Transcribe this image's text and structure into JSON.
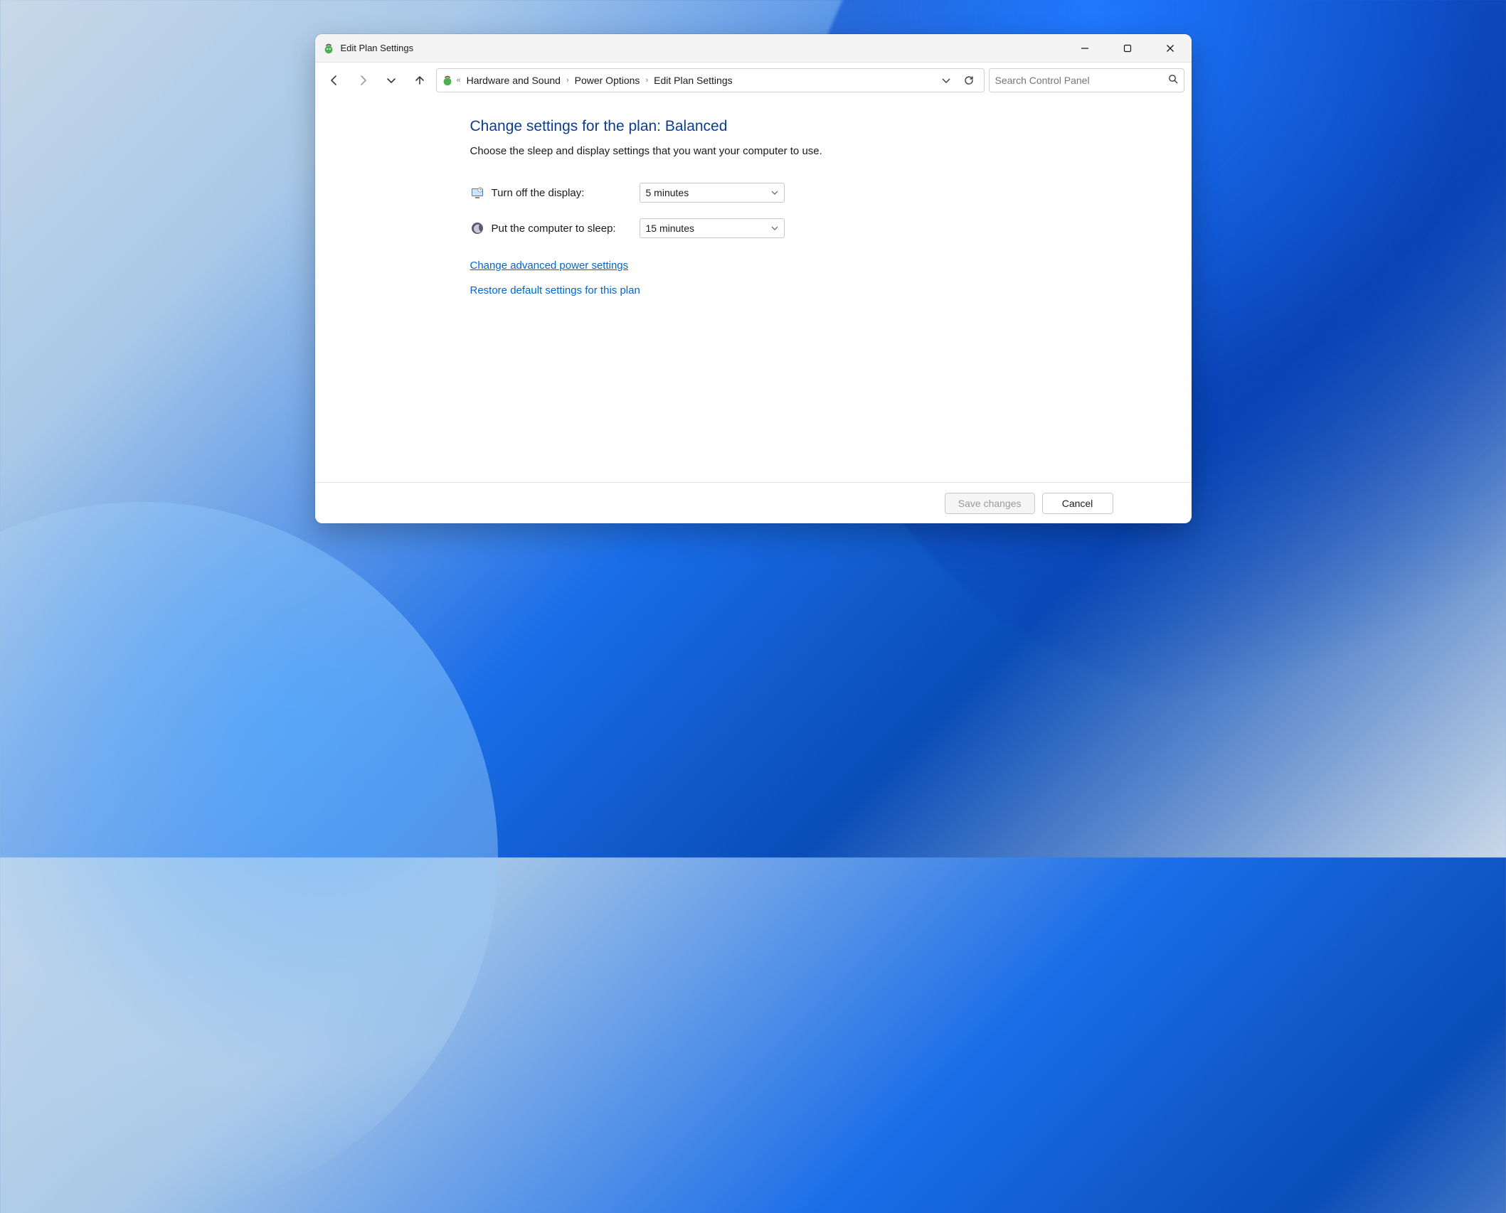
{
  "window": {
    "title": "Edit Plan Settings"
  },
  "breadcrumb": {
    "items": [
      "Hardware and Sound",
      "Power Options",
      "Edit Plan Settings"
    ]
  },
  "search": {
    "placeholder": "Search Control Panel"
  },
  "page": {
    "title": "Change settings for the plan: Balanced",
    "subtitle": "Choose the sleep and display settings that you want your computer to use."
  },
  "settings": {
    "display_off": {
      "label": "Turn off the display:",
      "value": "5 minutes"
    },
    "sleep": {
      "label": "Put the computer to sleep:",
      "value": "15 minutes"
    }
  },
  "links": {
    "advanced": "Change advanced power settings",
    "restore": "Restore default settings for this plan"
  },
  "buttons": {
    "save": "Save changes",
    "cancel": "Cancel"
  }
}
